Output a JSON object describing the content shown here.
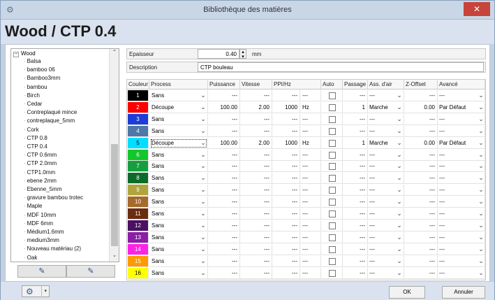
{
  "window": {
    "title": "Bibliothèque des matières",
    "close_glyph": "✕"
  },
  "header": {
    "material_title": "Wood / CTP 0.4"
  },
  "tree": {
    "root": "Wood",
    "items": [
      "Balsa",
      "bamboo 06",
      "Bamboo3mm",
      "bambou",
      "Birch",
      "Cedar",
      "Contreplaqué mince",
      "contreplaque_5mm",
      "Cork",
      "CTP  0.8",
      "CTP 0.4",
      "CTP 0.6mm",
      "CTP 2.0mm",
      "CTP1.0mm",
      "ebene 2mm",
      "Ebenne_5mm",
      "gravure bambou trotec",
      "Maple",
      "MDF 10mm",
      "MDF 6mm",
      "Médium1.6mm",
      "medium3mm",
      "Nouveau matériau (2)",
      "Oak"
    ]
  },
  "form": {
    "epaisseur_label": "Epaisseur",
    "epaisseur_value": "0.40",
    "epaisseur_unit": "mm",
    "description_label": "Description",
    "description_value": "CTP bouleau"
  },
  "table": {
    "headers": [
      "Couleur",
      "Process",
      "Puissance",
      "Vitesse",
      "PPI/Hz",
      "Auto",
      "Passage",
      "Ass. d'air",
      "Z-Offset",
      "Avancé"
    ],
    "rows": [
      {
        "n": "1",
        "color": "#000000",
        "process": "Sans",
        "puissance": "---",
        "vitesse": "---",
        "ppi": "---",
        "unit": "---",
        "passage": "---",
        "air": "---",
        "z": "---",
        "avance": "---"
      },
      {
        "n": "2",
        "color": "#ff0000",
        "process": "Découpe",
        "puissance": "100.00",
        "vitesse": "2.00",
        "ppi": "1000",
        "unit": "Hz",
        "passage": "1",
        "air": "Marche",
        "z": "0.00",
        "avance": "Par Défaut"
      },
      {
        "n": "3",
        "color": "#1e3cd6",
        "process": "Sans",
        "puissance": "---",
        "vitesse": "---",
        "ppi": "---",
        "unit": "---",
        "passage": "---",
        "air": "---",
        "z": "---",
        "avance": "---"
      },
      {
        "n": "4",
        "color": "#4f77a8",
        "process": "Sans",
        "puissance": "---",
        "vitesse": "---",
        "ppi": "---",
        "unit": "---",
        "passage": "---",
        "air": "---",
        "z": "---",
        "avance": "---"
      },
      {
        "n": "5",
        "color": "#00dfff",
        "process": "Découpe",
        "puissance": "100.00",
        "vitesse": "2.00",
        "ppi": "1000",
        "unit": "Hz",
        "passage": "1",
        "air": "Marche",
        "z": "0.00",
        "avance": "Par Défaut"
      },
      {
        "n": "6",
        "color": "#12c72a",
        "process": "Sans",
        "puissance": "---",
        "vitesse": "---",
        "ppi": "---",
        "unit": "---",
        "passage": "---",
        "air": "---",
        "z": "---",
        "avance": "---"
      },
      {
        "n": "7",
        "color": "#169f3e",
        "process": "Sans",
        "puissance": "---",
        "vitesse": "---",
        "ppi": "---",
        "unit": "---",
        "passage": "---",
        "air": "---",
        "z": "---",
        "avance": "---"
      },
      {
        "n": "8",
        "color": "#0c6b2b",
        "process": "Sans",
        "puissance": "---",
        "vitesse": "---",
        "ppi": "---",
        "unit": "---",
        "passage": "---",
        "air": "---",
        "z": "---",
        "avance": "---"
      },
      {
        "n": "9",
        "color": "#b0a43c",
        "process": "Sans",
        "puissance": "---",
        "vitesse": "---",
        "ppi": "---",
        "unit": "---",
        "passage": "---",
        "air": "---",
        "z": "---",
        "avance": "---"
      },
      {
        "n": "10",
        "color": "#a66a2c",
        "process": "Sans",
        "puissance": "---",
        "vitesse": "---",
        "ppi": "---",
        "unit": "---",
        "passage": "---",
        "air": "---",
        "z": "---",
        "avance": "---"
      },
      {
        "n": "11",
        "color": "#6a2d10",
        "process": "Sans",
        "puissance": "---",
        "vitesse": "---",
        "ppi": "---",
        "unit": "---",
        "passage": "---",
        "air": "---",
        "z": "---",
        "avance": "---"
      },
      {
        "n": "12",
        "color": "#4b0f63",
        "process": "Sans",
        "puissance": "---",
        "vitesse": "---",
        "ppi": "---",
        "unit": "---",
        "passage": "---",
        "air": "---",
        "z": "---",
        "avance": "---"
      },
      {
        "n": "13",
        "color": "#8a1ea6",
        "process": "Sans",
        "puissance": "---",
        "vitesse": "---",
        "ppi": "---",
        "unit": "---",
        "passage": "---",
        "air": "---",
        "z": "---",
        "avance": "---"
      },
      {
        "n": "14",
        "color": "#ff23e5",
        "process": "Sans",
        "puissance": "---",
        "vitesse": "---",
        "ppi": "---",
        "unit": "---",
        "passage": "---",
        "air": "---",
        "z": "---",
        "avance": "---"
      },
      {
        "n": "15",
        "color": "#ff9a00",
        "process": "Sans",
        "puissance": "---",
        "vitesse": "---",
        "ppi": "---",
        "unit": "---",
        "passage": "---",
        "air": "---",
        "z": "---",
        "avance": "---"
      },
      {
        "n": "16",
        "color": "#ffff00",
        "process": "Sans",
        "puissance": "---",
        "vitesse": "---",
        "ppi": "---",
        "unit": "---",
        "passage": "---",
        "air": "---",
        "z": "---",
        "avance": "---"
      }
    ]
  },
  "buttons": {
    "ok": "OK",
    "cancel": "Annuler"
  },
  "icons": {
    "gear": "gear-icon",
    "add_material": "add-material-icon",
    "copy_material": "copy-material-icon"
  }
}
